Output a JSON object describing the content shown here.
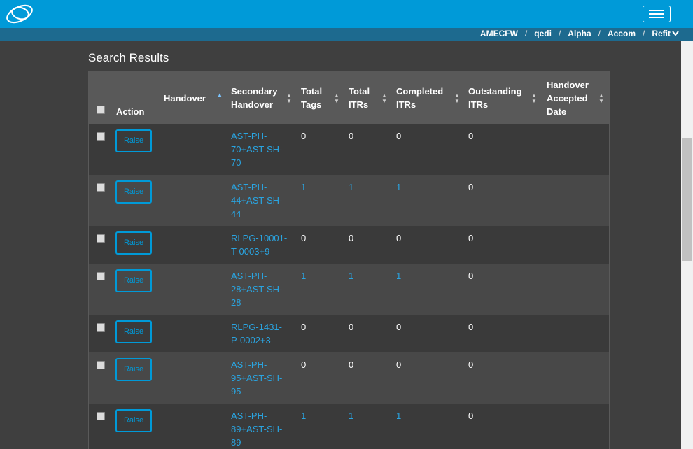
{
  "nav": {
    "logo": "app-logo",
    "menu_icon": "hamburger-icon"
  },
  "breadcrumb": [
    "AMECFW",
    "qedi",
    "Alpha",
    "Accom",
    "Refit"
  ],
  "page": {
    "title": "Search Results"
  },
  "table": {
    "headers": {
      "action": "Action",
      "handover": "Handover",
      "secondary_handover": [
        "Secondary",
        "Handover"
      ],
      "total_tags": [
        "Total",
        "Tags"
      ],
      "total_itrs": [
        "Total",
        "ITRs"
      ],
      "completed_itrs": [
        "Completed",
        "ITRs"
      ],
      "outstanding_itrs": [
        "Outstanding",
        "ITRs"
      ],
      "handover_accepted_date": [
        "Handover",
        "Accepted",
        "Date"
      ]
    },
    "raise_label": "Raise",
    "rows": [
      {
        "secondary": [
          "AST-PH-",
          "70+AST-SH-",
          "70"
        ],
        "total_tags": "0",
        "total_itrs": "0",
        "completed_itrs": "0",
        "outstanding_itrs": "0"
      },
      {
        "secondary": [
          "AST-PH-",
          "44+AST-SH-",
          "44"
        ],
        "total_tags": "1",
        "total_itrs": "1",
        "completed_itrs": "1",
        "outstanding_itrs": "0"
      },
      {
        "secondary": [
          "RLPG-10001-",
          "T-0003+9"
        ],
        "total_tags": "0",
        "total_itrs": "0",
        "completed_itrs": "0",
        "outstanding_itrs": "0"
      },
      {
        "secondary": [
          "AST-PH-",
          "28+AST-SH-",
          "28"
        ],
        "total_tags": "1",
        "total_itrs": "1",
        "completed_itrs": "1",
        "outstanding_itrs": "0"
      },
      {
        "secondary": [
          "RLPG-1431-",
          "P-0002+3"
        ],
        "total_tags": "0",
        "total_itrs": "0",
        "completed_itrs": "0",
        "outstanding_itrs": "0"
      },
      {
        "secondary": [
          "AST-PH-",
          "95+AST-SH-",
          "95"
        ],
        "total_tags": "0",
        "total_itrs": "0",
        "completed_itrs": "0",
        "outstanding_itrs": "0"
      },
      {
        "secondary": [
          "AST-PH-",
          "89+AST-SH-",
          "89"
        ],
        "total_tags": "1",
        "total_itrs": "1",
        "completed_itrs": "1",
        "outstanding_itrs": "0"
      }
    ]
  },
  "colors": {
    "brand": "#009ad8",
    "link": "#2aa4e0",
    "breadcrumb_bg": "#1d6a8f"
  }
}
